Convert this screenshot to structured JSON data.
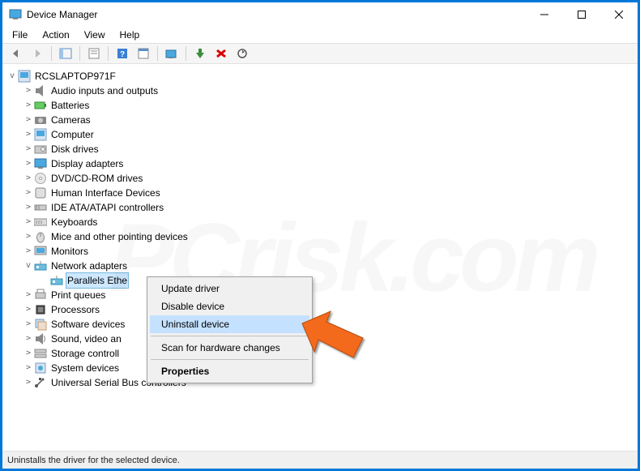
{
  "window": {
    "title": "Device Manager"
  },
  "menubar": {
    "file": "File",
    "action": "Action",
    "view": "View",
    "help": "Help"
  },
  "tree": {
    "root": "RCSLAPTOP971F",
    "items": [
      {
        "label": "Audio inputs and outputs",
        "icon": "speaker"
      },
      {
        "label": "Batteries",
        "icon": "battery"
      },
      {
        "label": "Cameras",
        "icon": "camera"
      },
      {
        "label": "Computer",
        "icon": "computer"
      },
      {
        "label": "Disk drives",
        "icon": "disk"
      },
      {
        "label": "Display adapters",
        "icon": "display"
      },
      {
        "label": "DVD/CD-ROM drives",
        "icon": "dvd"
      },
      {
        "label": "Human Interface Devices",
        "icon": "hid"
      },
      {
        "label": "IDE ATA/ATAPI controllers",
        "icon": "ide"
      },
      {
        "label": "Keyboards",
        "icon": "keyboard"
      },
      {
        "label": "Mice and other pointing devices",
        "icon": "mouse"
      },
      {
        "label": "Monitors",
        "icon": "monitor"
      },
      {
        "label": "Network adapters",
        "icon": "network",
        "expanded": true,
        "children": [
          {
            "label": "Parallels Ethernet Adapter",
            "icon": "network",
            "selected": true,
            "visible_label": "Parallels Ethe"
          }
        ]
      },
      {
        "label": "Print queues",
        "icon": "printer"
      },
      {
        "label": "Processors",
        "icon": "cpu"
      },
      {
        "label": "Software devices",
        "icon": "software"
      },
      {
        "label": "Sound, video and game controllers",
        "icon": "sound",
        "visible_label": "Sound, video an"
      },
      {
        "label": "Storage controllers",
        "icon": "storage",
        "visible_label": "Storage controll"
      },
      {
        "label": "System devices",
        "icon": "system"
      },
      {
        "label": "Universal Serial Bus controllers",
        "icon": "usb"
      }
    ]
  },
  "context_menu": {
    "items": [
      {
        "label": "Update driver"
      },
      {
        "label": "Disable device"
      },
      {
        "label": "Uninstall device",
        "highlighted": true
      },
      {
        "type": "sep"
      },
      {
        "label": "Scan for hardware changes"
      },
      {
        "type": "sep"
      },
      {
        "label": "Properties",
        "bold": true
      }
    ]
  },
  "statusbar": {
    "text": "Uninstalls the driver for the selected device."
  },
  "watermark": "PCrisk.com"
}
